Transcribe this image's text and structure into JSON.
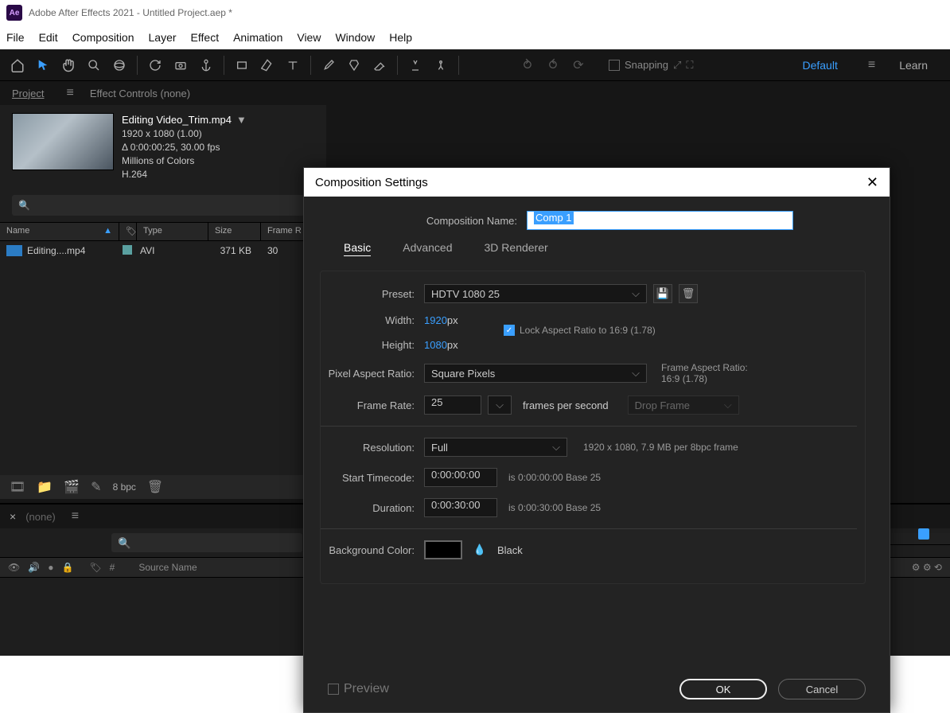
{
  "window": {
    "title": "Adobe After Effects 2021 - Untitled Project.aep *",
    "logo": "Ae"
  },
  "menu": {
    "file": "File",
    "edit": "Edit",
    "composition": "Composition",
    "layer": "Layer",
    "effect": "Effect",
    "animation": "Animation",
    "view": "View",
    "window": "Window",
    "help": "Help"
  },
  "toolbar": {
    "snapping": "Snapping",
    "default": "Default",
    "learn": "Learn"
  },
  "panels": {
    "project": "Project",
    "effect_controls": "Effect Controls (none)"
  },
  "clip": {
    "name": "Editing Video_Trim.mp4",
    "dim": "1920 x 1080 (1.00)",
    "dur": "Δ 0:00:00:25, 30.00 fps",
    "colors": "Millions of Colors",
    "codec": "H.264"
  },
  "assets": {
    "headers": {
      "name": "Name",
      "type": "Type",
      "size": "Size",
      "fr": "Frame R"
    },
    "row": {
      "name": "Editing....mp4",
      "type": "AVI",
      "size": "371 KB",
      "fr": "30"
    }
  },
  "bottom": {
    "bpc": "8 bpc"
  },
  "timeline": {
    "none": "(none)",
    "hash": "#",
    "src": "Source Name"
  },
  "dialog": {
    "title": "Composition Settings",
    "name_label": "Composition Name:",
    "name_value": "Comp 1",
    "tabs": {
      "basic": "Basic",
      "advanced": "Advanced",
      "renderer": "3D Renderer"
    },
    "preset_label": "Preset:",
    "preset_value": "HDTV 1080 25",
    "width_label": "Width:",
    "width_val": "1920",
    "px": " px",
    "height_label": "Height:",
    "height_val": "1080",
    "lock": "Lock Aspect Ratio to 16:9 (1.78)",
    "par_label": "Pixel Aspect Ratio:",
    "par_value": "Square Pixels",
    "far_label": "Frame Aspect Ratio:",
    "far_value": "16:9 (1.78)",
    "fr_label": "Frame Rate:",
    "fr_value": "25",
    "fps": "frames per second",
    "drop": "Drop Frame",
    "res_label": "Resolution:",
    "res_value": "Full",
    "res_info": "1920 x 1080, 7.9 MB per 8bpc frame",
    "stc_label": "Start Timecode:",
    "stc_value": "0:00:00:00",
    "stc_info": "is 0:00:00:00  Base 25",
    "dur_label": "Duration:",
    "dur_value": "0:00:30:00",
    "dur_info": "is 0:00:30:00  Base 25",
    "bg_label": "Background Color:",
    "bg_name": "Black",
    "preview": "Preview",
    "ok": "OK",
    "cancel": "Cancel"
  }
}
